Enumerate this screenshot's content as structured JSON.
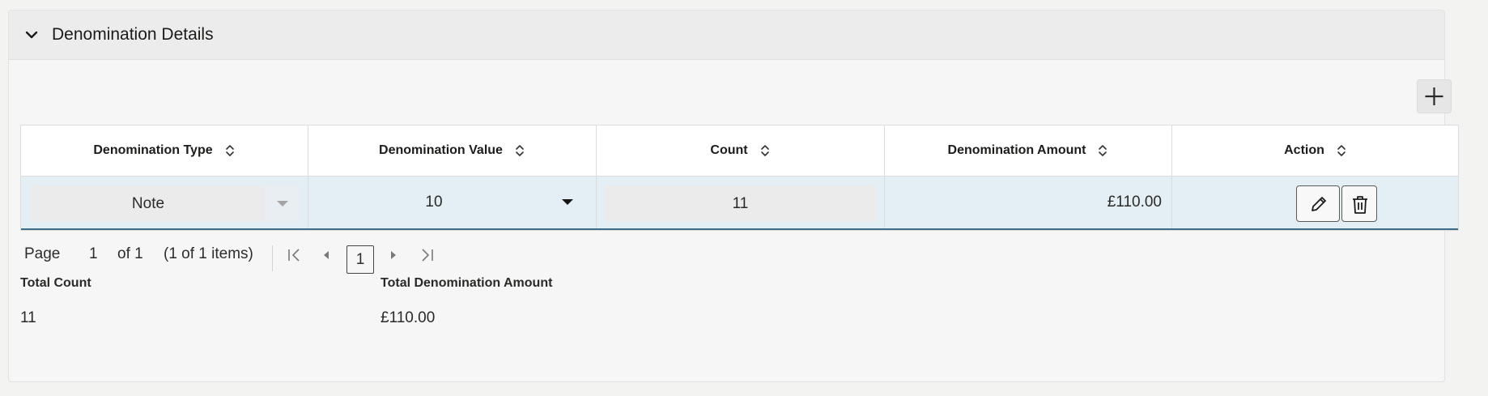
{
  "panel": {
    "title": "Denomination Details",
    "collapse_icon": "chevron-down-icon",
    "add_icon": "plus-icon"
  },
  "table": {
    "columns": [
      {
        "label": "Denomination Type"
      },
      {
        "label": "Denomination Value"
      },
      {
        "label": "Count"
      },
      {
        "label": "Denomination Amount"
      },
      {
        "label": "Action"
      }
    ],
    "rows": [
      {
        "denomination_type": "Note",
        "denomination_value": "10",
        "count": "11",
        "denomination_amount": "£110.00"
      }
    ]
  },
  "pagination": {
    "page_label": "Page",
    "current_page": "1",
    "of_label": "of 1",
    "items_summary": "(1 of 1 items)",
    "page_button": "1"
  },
  "totals": {
    "count_label": "Total Count",
    "count_value": "11",
    "amount_label": "Total Denomination Amount",
    "amount_value": "£110.00"
  },
  "colors": {
    "row_selected": "#e3eff4",
    "row_accent": "#3c6e87"
  }
}
